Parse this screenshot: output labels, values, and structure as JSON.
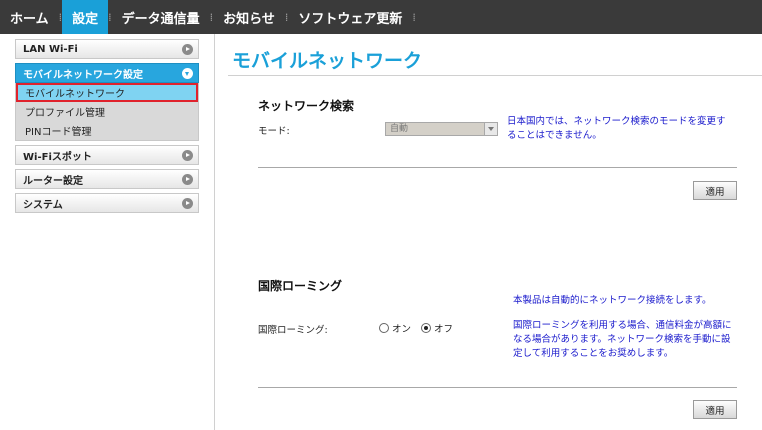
{
  "nav": {
    "items": [
      {
        "label": "ホーム",
        "active": false
      },
      {
        "label": "設定",
        "active": true
      },
      {
        "label": "データ通信量",
        "active": false
      },
      {
        "label": "お知らせ",
        "active": false
      },
      {
        "label": "ソフトウェア更新",
        "active": false
      }
    ],
    "separator": "⁞"
  },
  "sidebar": {
    "lan_wifi": "LAN Wi-Fi",
    "mobile_network_settings": "モバイルネットワーク設定",
    "sub_items": [
      "モバイルネットワーク",
      "プロファイル管理",
      "PINコード管理"
    ],
    "wifi_spot": "Wi-Fiスポット",
    "router_settings": "ルーター設定",
    "system": "システム"
  },
  "main": {
    "title": "モバイルネットワーク",
    "network_search": {
      "heading": "ネットワーク検索",
      "mode_label": "モード:",
      "mode_value": "自動",
      "note_line1": "日本国内では、ネットワーク検索のモードを変更す",
      "note_line2": "ることはできません。",
      "apply": "適用"
    },
    "roaming": {
      "heading": "国際ローミング",
      "auto_note": "本製品は自動的にネットワーク接続をします。",
      "label": "国際ローミング:",
      "option_on": "オン",
      "option_off": "オフ",
      "selected": "オフ",
      "warning_line1": "国際ローミングを利用する場合、通信料金が高額に",
      "warning_line2": "なる場合があります。ネットワーク検索を手動に設",
      "warning_line3": "定して利用することをお奨めします。",
      "apply": "適用"
    }
  },
  "colors": {
    "accent": "#1aa0d8",
    "nav_bg": "#3a3a3a",
    "note_text": "#1a1acc",
    "highlight_border": "#e0222c"
  }
}
